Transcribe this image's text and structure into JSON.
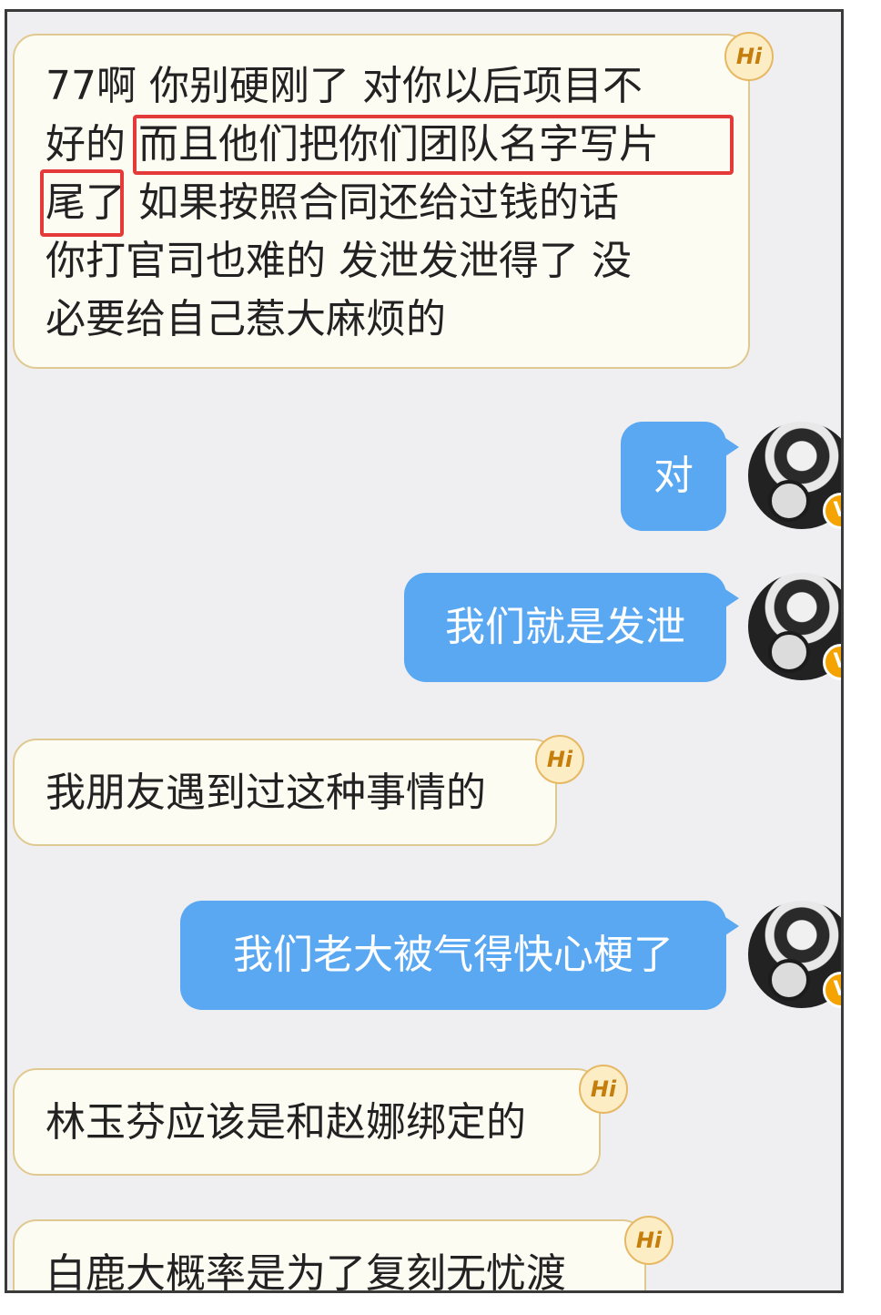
{
  "badges": {
    "hi": "Hi",
    "verified": "V"
  },
  "messages": [
    {
      "side": "incoming",
      "lines": [
        "77啊 你别硬刚了 对你以后项目不",
        "好的 而且他们把你们团队名字写片",
        "尾了 如果按照合同还给过钱的话",
        "你打官司也难的 发泄发泄得了 没",
        "必要给自己惹大麻烦的"
      ]
    },
    {
      "side": "outgoing",
      "text": "对"
    },
    {
      "side": "outgoing",
      "text": "我们就是发泄"
    },
    {
      "side": "incoming",
      "lines": [
        "我朋友遇到过这种事情的"
      ]
    },
    {
      "side": "outgoing",
      "text": "我们老大被气得快心梗了"
    },
    {
      "side": "incoming",
      "lines": [
        "林玉芬应该是和赵娜绑定的"
      ]
    },
    {
      "side": "incoming",
      "lines": [
        "白鹿大概率是为了复刻无忧渡"
      ]
    }
  ],
  "colors": {
    "outgoing_bubble": "#5aa8f2",
    "incoming_bubble": "#fdfcf3",
    "incoming_border": "#e0c990",
    "highlight": "#e53a3a",
    "chat_background": "#efeff1"
  }
}
